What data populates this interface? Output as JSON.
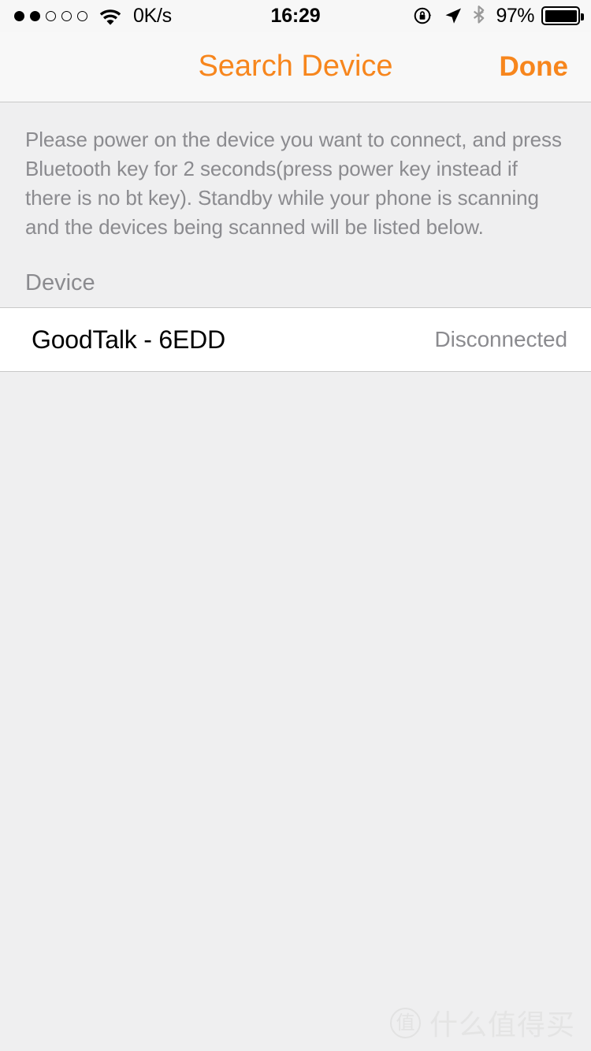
{
  "status_bar": {
    "carrier_signal": {
      "total_dots": 5,
      "filled_dots": 2
    },
    "wifi_icon": "wifi-icon",
    "network_speed": "0K/s",
    "time": "16:29",
    "rotation_lock_icon": "rotation-lock-icon",
    "location_icon": "location-arrow-icon",
    "bluetooth_icon": "bluetooth-icon",
    "battery_percent": "97%",
    "battery_level": 100
  },
  "nav_bar": {
    "title": "Search Device",
    "done_label": "Done",
    "accent_color": "#f7861d"
  },
  "main": {
    "instructions": "Please power on the device you want to connect, and press Bluetooth key for 2 seconds(press power key instead if there is no bt key). Standby while your phone is scanning and the devices being scanned will be listed below.",
    "section_header": "Device",
    "devices": [
      {
        "name": "GoodTalk - 6EDD",
        "status": "Disconnected"
      }
    ]
  },
  "watermark": {
    "logo_char": "值",
    "text": "什么值得买"
  }
}
